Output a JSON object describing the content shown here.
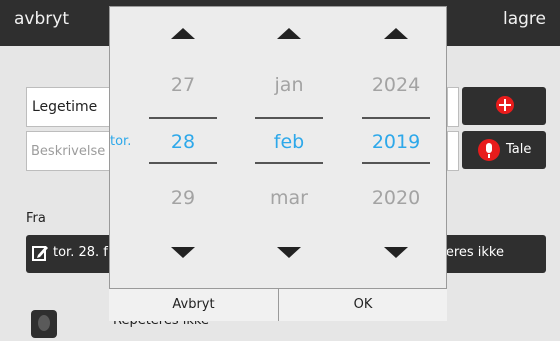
{
  "topbar": {
    "left_label": "avbryt",
    "right_label": "lagre"
  },
  "form": {
    "title_value": "Legetime",
    "description_placeholder": "Beskrivelse",
    "tale_label": "Tale",
    "fra_label": "Fra",
    "date_bar_text": "tor. 28. f",
    "repeat_bar_text": "eres ikke",
    "repeat_bottom_text": "Repeteres ikke"
  },
  "picker": {
    "weekday_label": "tor.",
    "day": {
      "prev": "27",
      "selected": "28",
      "next": "29"
    },
    "month": {
      "prev": "jan",
      "selected": "feb",
      "next": "mar"
    },
    "year": {
      "prev": "2024",
      "selected": "2019",
      "next": "2020"
    },
    "cancel_label": "Avbryt",
    "ok_label": "OK"
  },
  "colors": {
    "accent": "#2da8ea",
    "bar": "#2f2f2f",
    "red": "#e81c1c"
  }
}
